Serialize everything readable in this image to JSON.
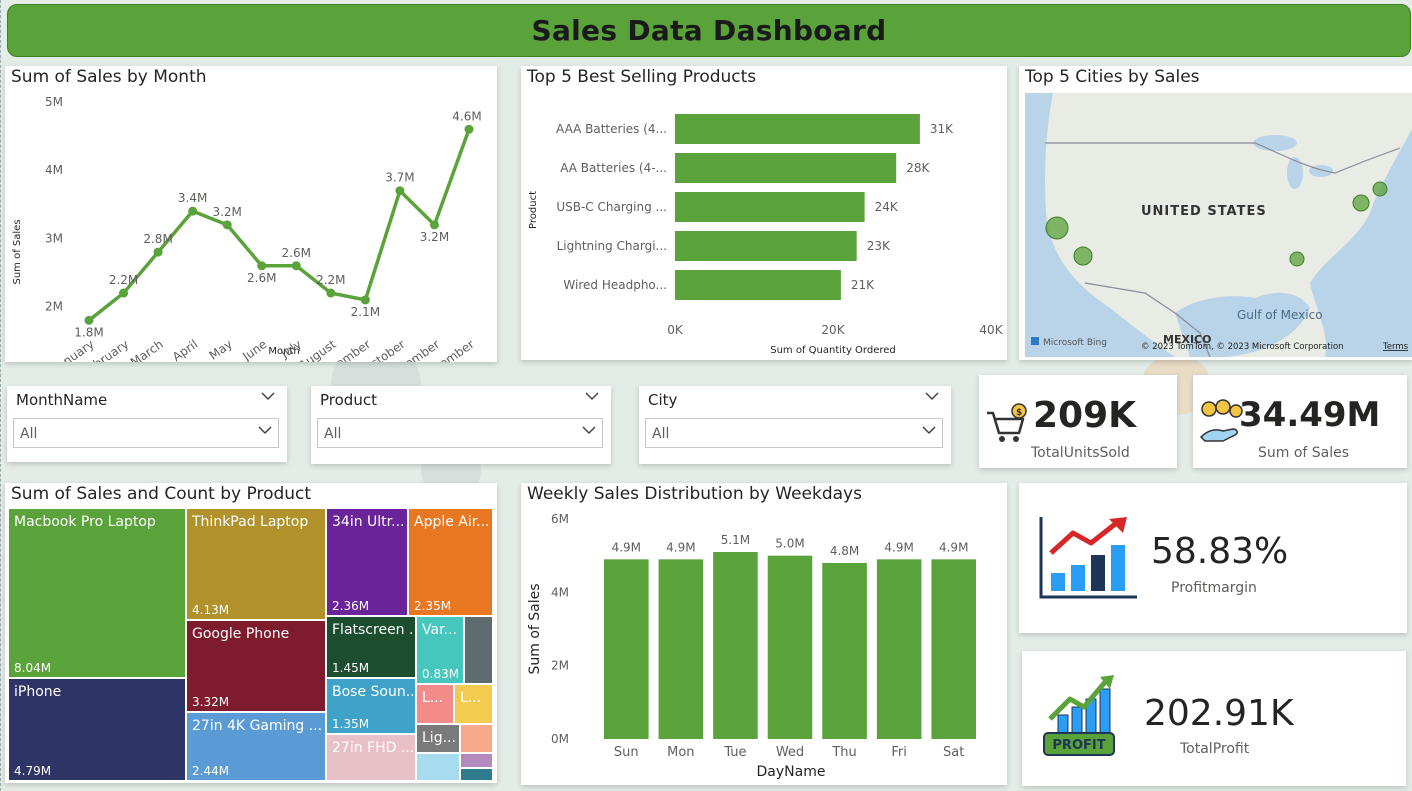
{
  "header": {
    "title": "Sales Data Dashboard"
  },
  "colors": {
    "accent": "#5aa23a",
    "bar": "#5aa23a",
    "line": "#5aa23a"
  },
  "line_card": {
    "title": "Sum of Sales by Month"
  },
  "bar_card": {
    "title": "Top 5 Best Selling Products"
  },
  "map_card": {
    "title": "Top 5 Cities by Sales",
    "country_label": "UNITED STATES",
    "gulf_label": "Gulf of Mexico",
    "mexico_label": "MEXICO",
    "attribution": "© 2023 TomTom, © 2023 Microsoft Corporation",
    "terms": "Terms",
    "logo_text": "Microsoft Bing"
  },
  "slicers": [
    {
      "title": "MonthName",
      "value": "All"
    },
    {
      "title": "Product",
      "value": "All"
    },
    {
      "title": "City",
      "value": "All"
    }
  ],
  "kpis": {
    "units": {
      "value": "209K",
      "label": "TotalUnitsSold",
      "icon": "cart-coin-icon"
    },
    "sales": {
      "value": "34.49M",
      "label": "Sum of Sales",
      "icon": "hand-coins-icon"
    },
    "margin": {
      "value": "58.83%",
      "label": "Profitmargin",
      "icon": "growth-chart-icon"
    },
    "profit": {
      "value": "202.91K",
      "label": "TotalProfit",
      "icon": "profit-chart-icon",
      "badge": "PROFIT"
    }
  },
  "treemap_card": {
    "title": "Sum of Sales and Count by Product",
    "cells": [
      {
        "name": "Macbook Pro Laptop",
        "value": "8.04M",
        "color": "#5aa23a"
      },
      {
        "name": "iPhone",
        "value": "4.79M",
        "color": "#2e3566"
      },
      {
        "name": "ThinkPad Laptop",
        "value": "4.13M",
        "color": "#b0912a"
      },
      {
        "name": "Google Phone",
        "value": "3.32M",
        "color": "#7e1b2c"
      },
      {
        "name": "27in 4K Gaming ...",
        "value": "2.44M",
        "color": "#5b9bd5"
      },
      {
        "name": "34in Ultr...",
        "value": "2.36M",
        "color": "#6a2398"
      },
      {
        "name": "Apple Air...",
        "value": "2.35M",
        "color": "#e87722"
      },
      {
        "name": "Flatscreen ...",
        "value": "1.45M",
        "color": "#1b4d2e"
      },
      {
        "name": "Bose Soun...",
        "value": "1.35M",
        "color": "#3ea2c9"
      },
      {
        "name": "27in FHD ...",
        "value": "",
        "color": "#e8c1c8"
      },
      {
        "name": "Var...",
        "value": "0.83M",
        "color": "#46c6bd"
      },
      {
        "name": "L...",
        "value": "",
        "color": "#f38b8b"
      },
      {
        "name": "L...",
        "value": "",
        "color": "#f3cb4e"
      },
      {
        "name": "Lig...",
        "value": "",
        "color": "#7a7a7a"
      },
      {
        "name": "",
        "value": "",
        "color": "#5f6b6e"
      },
      {
        "name": "",
        "value": "",
        "color": "#f9a98b"
      },
      {
        "name": "",
        "value": "",
        "color": "#a7dcef"
      },
      {
        "name": "",
        "value": "",
        "color": "#b38abd"
      },
      {
        "name": "",
        "value": "",
        "color": "#2d7b8c"
      }
    ]
  },
  "weekly_card": {
    "title": "Weekly Sales Distribution by Weekdays"
  },
  "chart_data": [
    {
      "type": "line",
      "title": "Sum of Sales by Month",
      "xlabel": "Month",
      "ylabel": "Sum of Sales",
      "categories": [
        "January",
        "February",
        "March",
        "April",
        "May",
        "June",
        "July",
        "August",
        "September",
        "October",
        "November",
        "December"
      ],
      "values": [
        1.8,
        2.2,
        2.8,
        3.4,
        3.2,
        2.6,
        2.6,
        2.2,
        2.1,
        3.7,
        3.2,
        4.6
      ],
      "data_labels": [
        "1.8M",
        "2.2M",
        "2.8M",
        "3.4M",
        "3.2M",
        "2.6M",
        "2.6M",
        "2.2M",
        "2.1M",
        "3.7M",
        "3.2M",
        "4.6M"
      ],
      "ylim": [
        1.6,
        5
      ],
      "yticks": [
        2,
        3,
        4,
        5
      ],
      "ytick_labels": [
        "2M",
        "3M",
        "4M",
        "5M"
      ],
      "grid": false
    },
    {
      "type": "bar",
      "orientation": "horizontal",
      "title": "Top 5 Best Selling Products",
      "xlabel": "Sum of Quantity Ordered",
      "ylabel": "Product",
      "categories": [
        "AAA Batteries (4...",
        "AA Batteries (4-...",
        "USB-C Charging ...",
        "Lightning Chargi...",
        "Wired Headpho..."
      ],
      "values": [
        31,
        28,
        24,
        23,
        21
      ],
      "data_labels": [
        "31K",
        "28K",
        "24K",
        "23K",
        "21K"
      ],
      "xlim": [
        0,
        40
      ],
      "xticks": [
        0,
        20,
        40
      ],
      "xtick_labels": [
        "0K",
        "20K",
        "40K"
      ]
    },
    {
      "type": "bar",
      "title": "Weekly Sales Distribution by Weekdays",
      "xlabel": "DayName",
      "ylabel": "Sum of Sales",
      "categories": [
        "Sun",
        "Mon",
        "Tue",
        "Wed",
        "Thu",
        "Fri",
        "Sat"
      ],
      "values": [
        4.9,
        4.9,
        5.1,
        5.0,
        4.8,
        4.9,
        4.9
      ],
      "data_labels": [
        "4.9M",
        "4.9M",
        "5.1M",
        "5.0M",
        "4.8M",
        "4.9M",
        "4.9M"
      ],
      "ylim": [
        0,
        6
      ],
      "yticks": [
        0,
        2,
        4,
        6
      ],
      "ytick_labels": [
        "0M",
        "2M",
        "4M",
        "6M"
      ]
    }
  ]
}
